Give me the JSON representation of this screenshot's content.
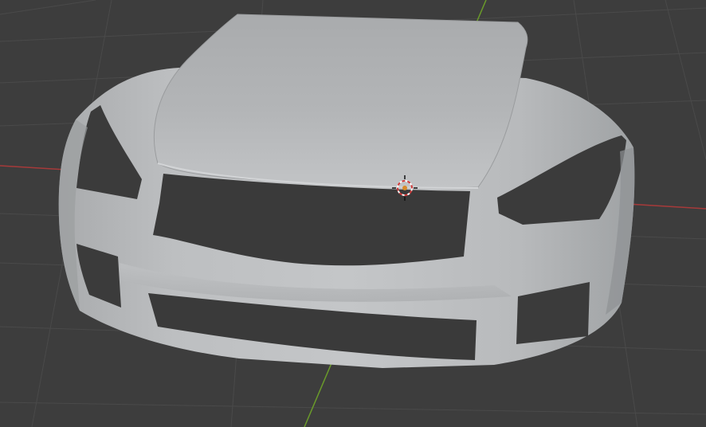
{
  "app": {
    "name": "",
    "view": "3D Viewport"
  },
  "viewport": {
    "background_color": "#3d3d3d",
    "grid_color": "#4a4a4a",
    "x_axis_color": "#a63a3a",
    "y_axis_color": "#6a9a2a",
    "model_color": "#b7b9bb",
    "model_shadow_color": "#9ea1a4",
    "cutout_color": "#3a3a3a"
  },
  "scene": {
    "object": "car-front-body-mesh",
    "cursor_icon": "3d-cursor-icon"
  }
}
